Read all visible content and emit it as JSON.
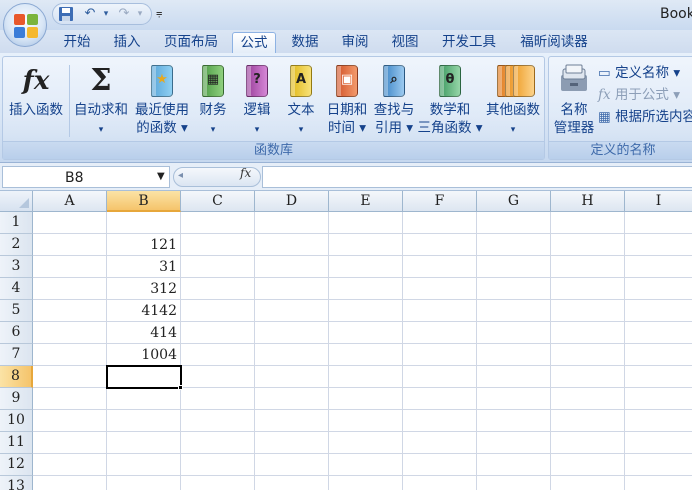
{
  "title": "Book",
  "quick_access": {
    "icons": [
      "save-icon",
      "undo-icon",
      "redo-icon"
    ]
  },
  "tabs": [
    "开始",
    "插入",
    "页面布局",
    "公式",
    "数据",
    "审阅",
    "视图",
    "开发工具",
    "福昕阅读器"
  ],
  "active_tab": "公式",
  "ribbon": {
    "function_library": {
      "label": "函数库",
      "buttons": [
        {
          "line1": "插入函数",
          "line2": ""
        },
        {
          "line1": "自动求和",
          "line2": "▾"
        },
        {
          "line1": "最近使用",
          "line2": "的函数 ▾"
        },
        {
          "line1": "财务",
          "line2": "▾"
        },
        {
          "line1": "逻辑",
          "line2": "▾"
        },
        {
          "line1": "文本",
          "line2": "▾"
        },
        {
          "line1": "日期和",
          "line2": "时间 ▾"
        },
        {
          "line1": "查找与",
          "line2": "引用 ▾"
        },
        {
          "line1": "数学和",
          "line2": "三角函数 ▾"
        },
        {
          "line1": "其他函数",
          "line2": "▾"
        }
      ]
    },
    "defined_names": {
      "label": "定义的名称",
      "name_manager": {
        "line1": "名称",
        "line2": "管理器"
      },
      "define_name": "定义名称 ▾",
      "use_in_formula": "用于公式 ▾",
      "create_from_selection": "根据所选内容创建"
    }
  },
  "formula_bar": {
    "name_box": "B8",
    "fx_label": "fx",
    "formula": ""
  },
  "sheet": {
    "columns": [
      "A",
      "B",
      "C",
      "D",
      "E",
      "F",
      "G",
      "H",
      "I"
    ],
    "rows": [
      "1",
      "2",
      "3",
      "4",
      "5",
      "6",
      "7",
      "8",
      "9",
      "10",
      "11",
      "12",
      "13"
    ],
    "selected_column": "B",
    "selected_row": "8",
    "column_b_values": [
      "",
      "121",
      "31",
      "312",
      "4142",
      "414",
      "1004"
    ]
  },
  "colors": {
    "ribbon_bg": "#d8e5f5",
    "tab_text": "#15428b",
    "selected_header": "#f5c46b"
  }
}
